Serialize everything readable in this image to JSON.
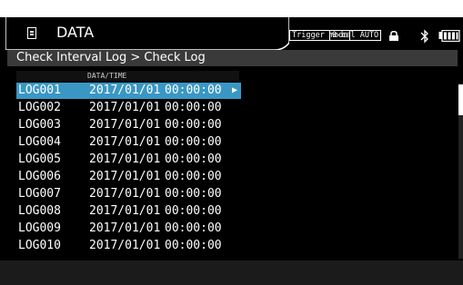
{
  "header": {
    "title": "DATA",
    "trigger_mode": "Trigger mode",
    "zero_cal": "0-cal AUTO"
  },
  "breadcrumb": "Check Interval Log > Check Log",
  "list": {
    "column_header": "DATA/TIME",
    "rows": [
      {
        "name": "LOG001",
        "date": "2017/01/01",
        "time": "00:00:00",
        "selected": true
      },
      {
        "name": "LOG002",
        "date": "2017/01/01",
        "time": "00:00:00"
      },
      {
        "name": "LOG003",
        "date": "2017/01/01",
        "time": "00:00:00"
      },
      {
        "name": "LOG004",
        "date": "2017/01/01",
        "time": "00:00:00"
      },
      {
        "name": "LOG005",
        "date": "2017/01/01",
        "time": "00:00:00"
      },
      {
        "name": "LOG006",
        "date": "2017/01/01",
        "time": "00:00:00"
      },
      {
        "name": "LOG007",
        "date": "2017/01/01",
        "time": "00:00:00"
      },
      {
        "name": "LOG008",
        "date": "2017/01/01",
        "time": "00:00:00"
      },
      {
        "name": "LOG009",
        "date": "2017/01/01",
        "time": "00:00:00"
      },
      {
        "name": "LOG010",
        "date": "2017/01/01",
        "time": "00:00:00"
      }
    ]
  },
  "icons": {
    "data": "document-icon",
    "lock": "lock-icon",
    "bluetooth": "bluetooth-icon",
    "battery": "battery-icon"
  },
  "colors": {
    "selection": "#3a97c4",
    "background": "#000000"
  }
}
